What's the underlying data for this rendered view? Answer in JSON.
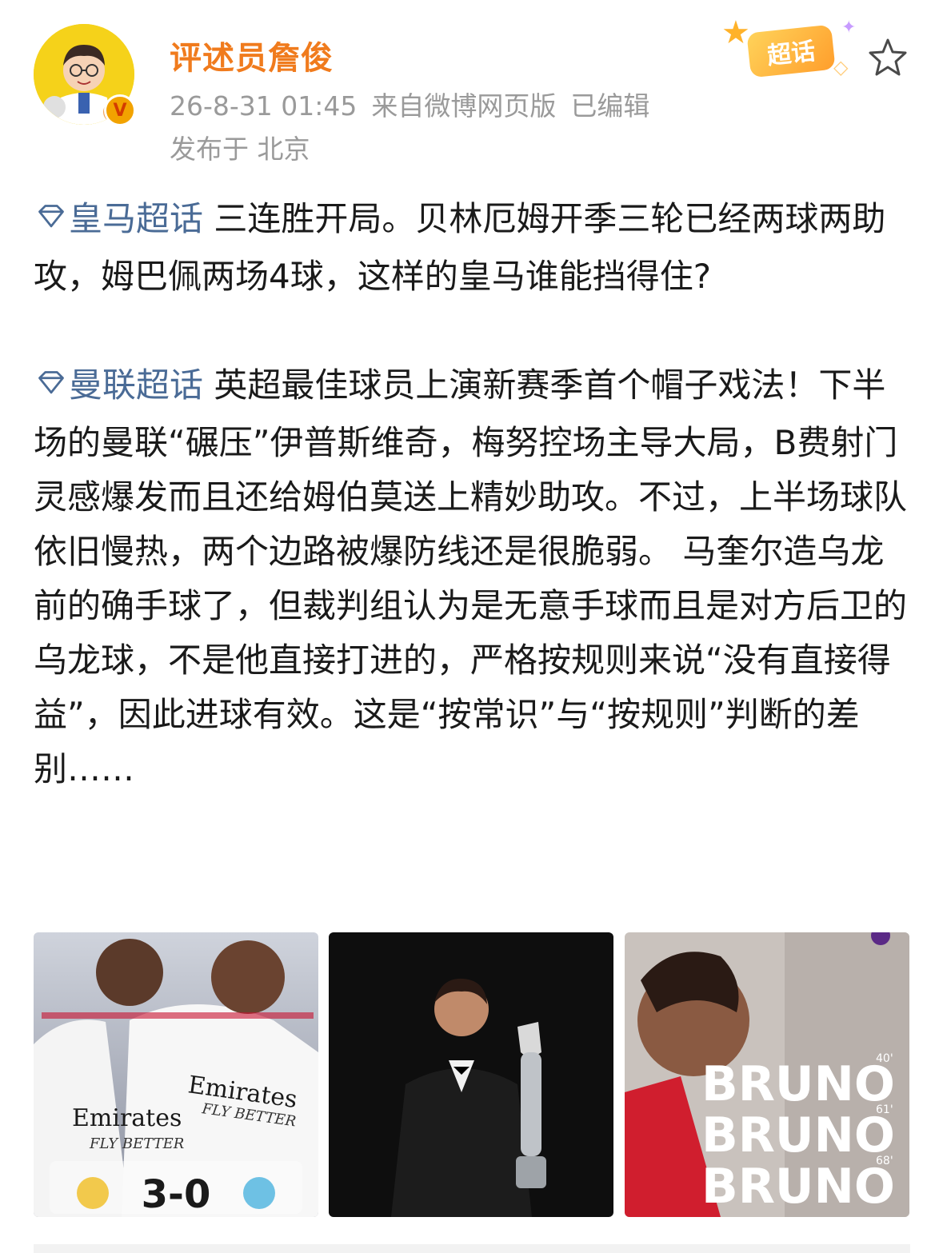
{
  "post": {
    "author": "评述员詹俊",
    "time": "26-8-31 01:45",
    "source": "来自微博网页版",
    "edited": "已编辑",
    "location": "发布于 北京",
    "badge_label": "超话",
    "verified_mark": "V"
  },
  "content": {
    "p1_topic": "皇马超话",
    "p1_text": " 三连胜开局。贝林厄姆开季三轮已经两球两助攻，姆巴佩两场4球，这样的皇马谁能挡得住?",
    "p2_topic": "曼联超话",
    "p2_text": " 英超最佳球员上演新赛季首个帽子戏法！下半场的曼联“碾压”伊普斯维奇，梅努控场主导大局，B费射门灵感爆发而且还给姆伯莫送上精妙助攻。不过，上半场球队依旧慢热，两个边路被爆防线还是很脆弱。 马奎尔造乌龙前的确手球了，但裁判组认为是无意手球而且是对方后卫的乌龙球，不是他直接打进的，严格按规则来说“没有直接得益”，因此进球有效。这是“按常识”与“按规则”判断的差别……"
  },
  "images": {
    "img1": {
      "score": "3-0",
      "sponsor": "Emirates",
      "sponsor_sub": "FLY BETTER",
      "sponsor2": "Emirates",
      "sponsor2_sub": "FLY BETTER"
    },
    "img3": {
      "lines": [
        "BRUNO",
        "BRUNO",
        "BRUNO"
      ],
      "minutes": [
        "40'",
        "61'",
        "68'"
      ]
    }
  },
  "colors": {
    "name": "#f07b1d",
    "topic": "#4a6b96",
    "meta": "#9a9a9a"
  },
  "icons": {
    "topic": "diamond-topic-icon",
    "favorite": "star-outline-icon"
  }
}
